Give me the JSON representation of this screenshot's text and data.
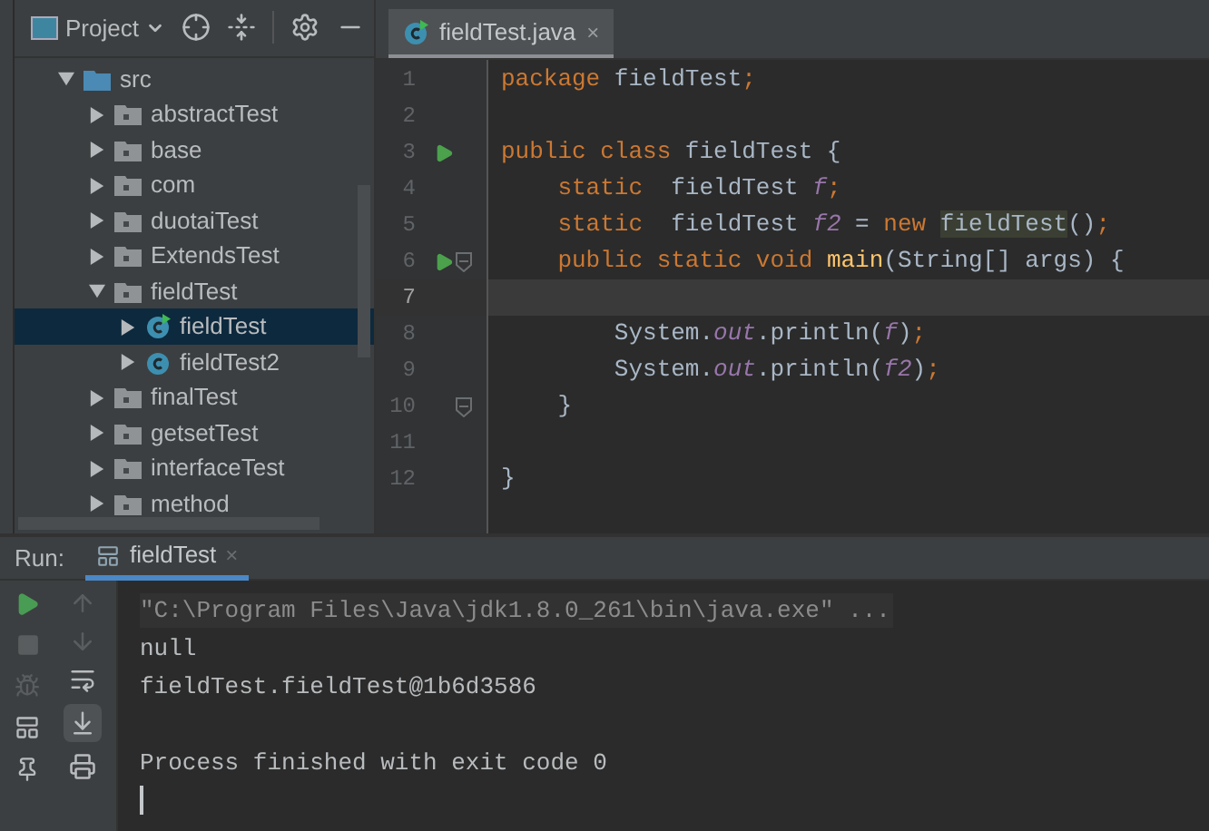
{
  "project_panel": {
    "title": "Project",
    "tree": [
      {
        "label": "src",
        "kind": "source-folder",
        "expanded": true,
        "selected": false,
        "children": [
          {
            "label": "abstractTest",
            "kind": "package",
            "expanded": false,
            "selected": false
          },
          {
            "label": "base",
            "kind": "package",
            "expanded": false,
            "selected": false
          },
          {
            "label": "com",
            "kind": "package",
            "expanded": false,
            "selected": false
          },
          {
            "label": "duotaiTest",
            "kind": "package",
            "expanded": false,
            "selected": false
          },
          {
            "label": "ExtendsTest",
            "kind": "package",
            "expanded": false,
            "selected": false
          },
          {
            "label": "fieldTest",
            "kind": "package",
            "expanded": true,
            "selected": false,
            "children": [
              {
                "label": "fieldTest",
                "kind": "class",
                "runnable": true,
                "expanded": false,
                "selected": true
              },
              {
                "label": "fieldTest2",
                "kind": "class",
                "runnable": false,
                "expanded": false,
                "selected": false
              }
            ]
          },
          {
            "label": "finalTest",
            "kind": "package",
            "expanded": false,
            "selected": false
          },
          {
            "label": "getsetTest",
            "kind": "package",
            "expanded": false,
            "selected": false
          },
          {
            "label": "interfaceTest",
            "kind": "package",
            "expanded": false,
            "selected": false
          },
          {
            "label": "method",
            "kind": "package",
            "expanded": false,
            "selected": false
          }
        ]
      }
    ]
  },
  "editor": {
    "tab": {
      "label": "fieldTest.java",
      "close": "×"
    },
    "lines": [
      {
        "number": "1",
        "run": false,
        "fold": false,
        "current": false,
        "tokens": [
          {
            "text": "package ",
            "kind": "keyword"
          },
          {
            "text": "fieldTest",
            "kind": "plain"
          },
          {
            "text": ";",
            "kind": "keyword"
          }
        ]
      },
      {
        "number": "2",
        "run": false,
        "fold": false,
        "current": false
      },
      {
        "number": "3",
        "run": true,
        "fold": false,
        "current": false,
        "tokens": [
          {
            "text": "public class ",
            "kind": "keyword"
          },
          {
            "text": "fieldTest {",
            "kind": "plain"
          }
        ]
      },
      {
        "number": "4",
        "run": false,
        "fold": false,
        "current": false,
        "tokens": [
          {
            "text": "    static  ",
            "kind": "keyword"
          },
          {
            "text": "fieldTest ",
            "kind": "plain"
          },
          {
            "text": "f",
            "kind": "static"
          },
          {
            "text": ";",
            "kind": "keyword"
          }
        ]
      },
      {
        "number": "5",
        "run": false,
        "fold": false,
        "current": false,
        "tokens": [
          {
            "text": "    static  ",
            "kind": "keyword"
          },
          {
            "text": "fieldTest ",
            "kind": "plain"
          },
          {
            "text": "f2",
            "kind": "static"
          },
          {
            "text": " = ",
            "kind": "plain"
          },
          {
            "text": "new ",
            "kind": "keyword"
          },
          {
            "text": "fieldTest",
            "kind": "highlight"
          },
          {
            "text": "()",
            "kind": "plain"
          },
          {
            "text": ";",
            "kind": "keyword"
          }
        ]
      },
      {
        "number": "6",
        "run": true,
        "fold": true,
        "current": false,
        "tokens": [
          {
            "text": "    public static void ",
            "kind": "keyword"
          },
          {
            "text": "main",
            "kind": "method"
          },
          {
            "text": "(String[] args) {",
            "kind": "plain"
          }
        ]
      },
      {
        "number": "7",
        "run": false,
        "fold": false,
        "current": true
      },
      {
        "number": "8",
        "run": false,
        "fold": false,
        "current": false,
        "tokens": [
          {
            "text": "        System.",
            "kind": "plain"
          },
          {
            "text": "out",
            "kind": "static"
          },
          {
            "text": ".println(",
            "kind": "plain"
          },
          {
            "text": "f",
            "kind": "static"
          },
          {
            "text": ")",
            "kind": "plain"
          },
          {
            "text": ";",
            "kind": "keyword"
          }
        ]
      },
      {
        "number": "9",
        "run": false,
        "fold": false,
        "current": false,
        "tokens": [
          {
            "text": "        System.",
            "kind": "plain"
          },
          {
            "text": "out",
            "kind": "static"
          },
          {
            "text": ".println(",
            "kind": "plain"
          },
          {
            "text": "f2",
            "kind": "static"
          },
          {
            "text": ")",
            "kind": "plain"
          },
          {
            "text": ";",
            "kind": "keyword"
          }
        ]
      },
      {
        "number": "10",
        "run": false,
        "fold": true,
        "current": false,
        "tokens": [
          {
            "text": "    }",
            "kind": "plain"
          }
        ]
      },
      {
        "number": "11",
        "run": false,
        "fold": false,
        "current": false
      },
      {
        "number": "12",
        "run": false,
        "fold": false,
        "current": false,
        "tokens": [
          {
            "text": "}",
            "kind": "plain"
          }
        ]
      }
    ]
  },
  "run_panel": {
    "label": "Run:",
    "tab": {
      "label": "fieldTest",
      "close": "×"
    },
    "console": [
      {
        "text": "\"C:\\Program Files\\Java\\jdk1.8.0_261\\bin\\java.exe\" ...",
        "kind": "command"
      },
      {
        "text": "null",
        "kind": "output"
      },
      {
        "text": "fieldTest.fieldTest@1b6d3586",
        "kind": "output"
      },
      {
        "kind": "blank"
      },
      {
        "text": "Process finished with exit code 0",
        "kind": "output"
      }
    ]
  }
}
